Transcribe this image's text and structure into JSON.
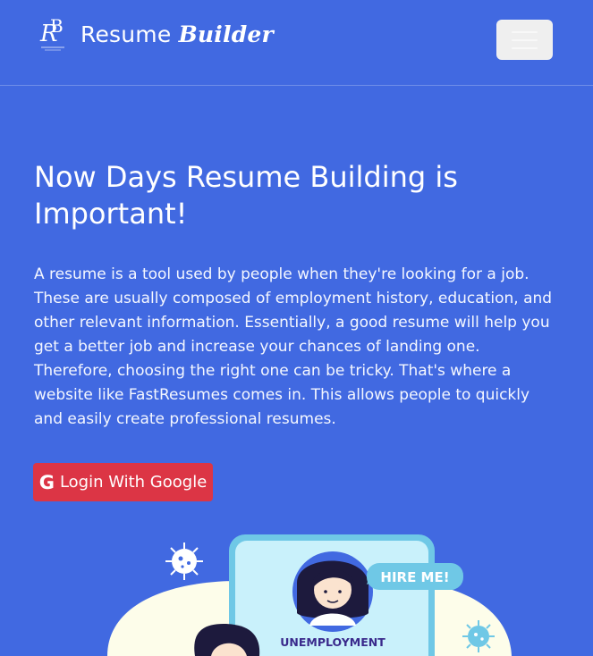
{
  "navbar": {
    "brand_name": "Resume ",
    "brand_name_stylized": "Builder",
    "logo_monogram": "RB",
    "toggle_icon": "hamburger-menu-icon"
  },
  "hero": {
    "title": "Now Days Resume Building is Important!",
    "description": "A resume is a tool used by people when they're looking for a job. These are usually composed of employment history, education, and other relevant information. Essentially, a good resume will help you get a better job and increase your chances of landing one. Therefore, choosing the right one can be tricky. That's where a website like FastResumes comes in. This allows people to quickly and easily create professional resumes.",
    "login_button": {
      "label": "Login With Google",
      "icon": "google-icon",
      "color": "#dc3545"
    }
  },
  "illustration": {
    "badge_text": "HIRE ME!",
    "phone_label": "UNEMPLOYMENT"
  },
  "colors": {
    "background": "#4169e1",
    "accent_red": "#dc3545",
    "phone_screen": "#c9f1fb",
    "badge": "#6fc8e6"
  }
}
